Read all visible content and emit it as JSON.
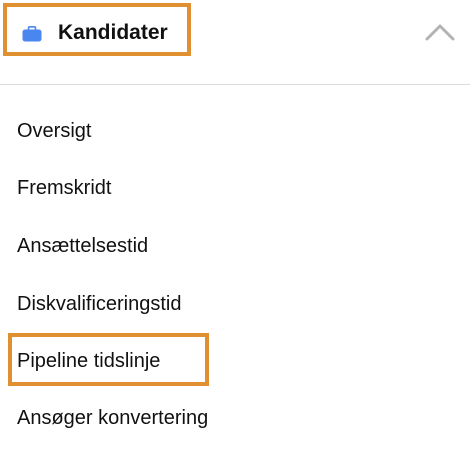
{
  "header": {
    "title": "Kandidater",
    "icon": "briefcase-icon",
    "icon_color": "#4A86F0",
    "collapse_icon": "chevron-up-icon",
    "highlight_color": "#E08F31"
  },
  "nav": {
    "items": [
      {
        "label": "Oversigt"
      },
      {
        "label": "Fremskridt"
      },
      {
        "label": "Ansættelsestid"
      },
      {
        "label": "Diskvalificeringstid"
      },
      {
        "label": "Pipeline tidslinje",
        "highlighted": true
      },
      {
        "label": "Ansøger konvertering"
      }
    ]
  }
}
